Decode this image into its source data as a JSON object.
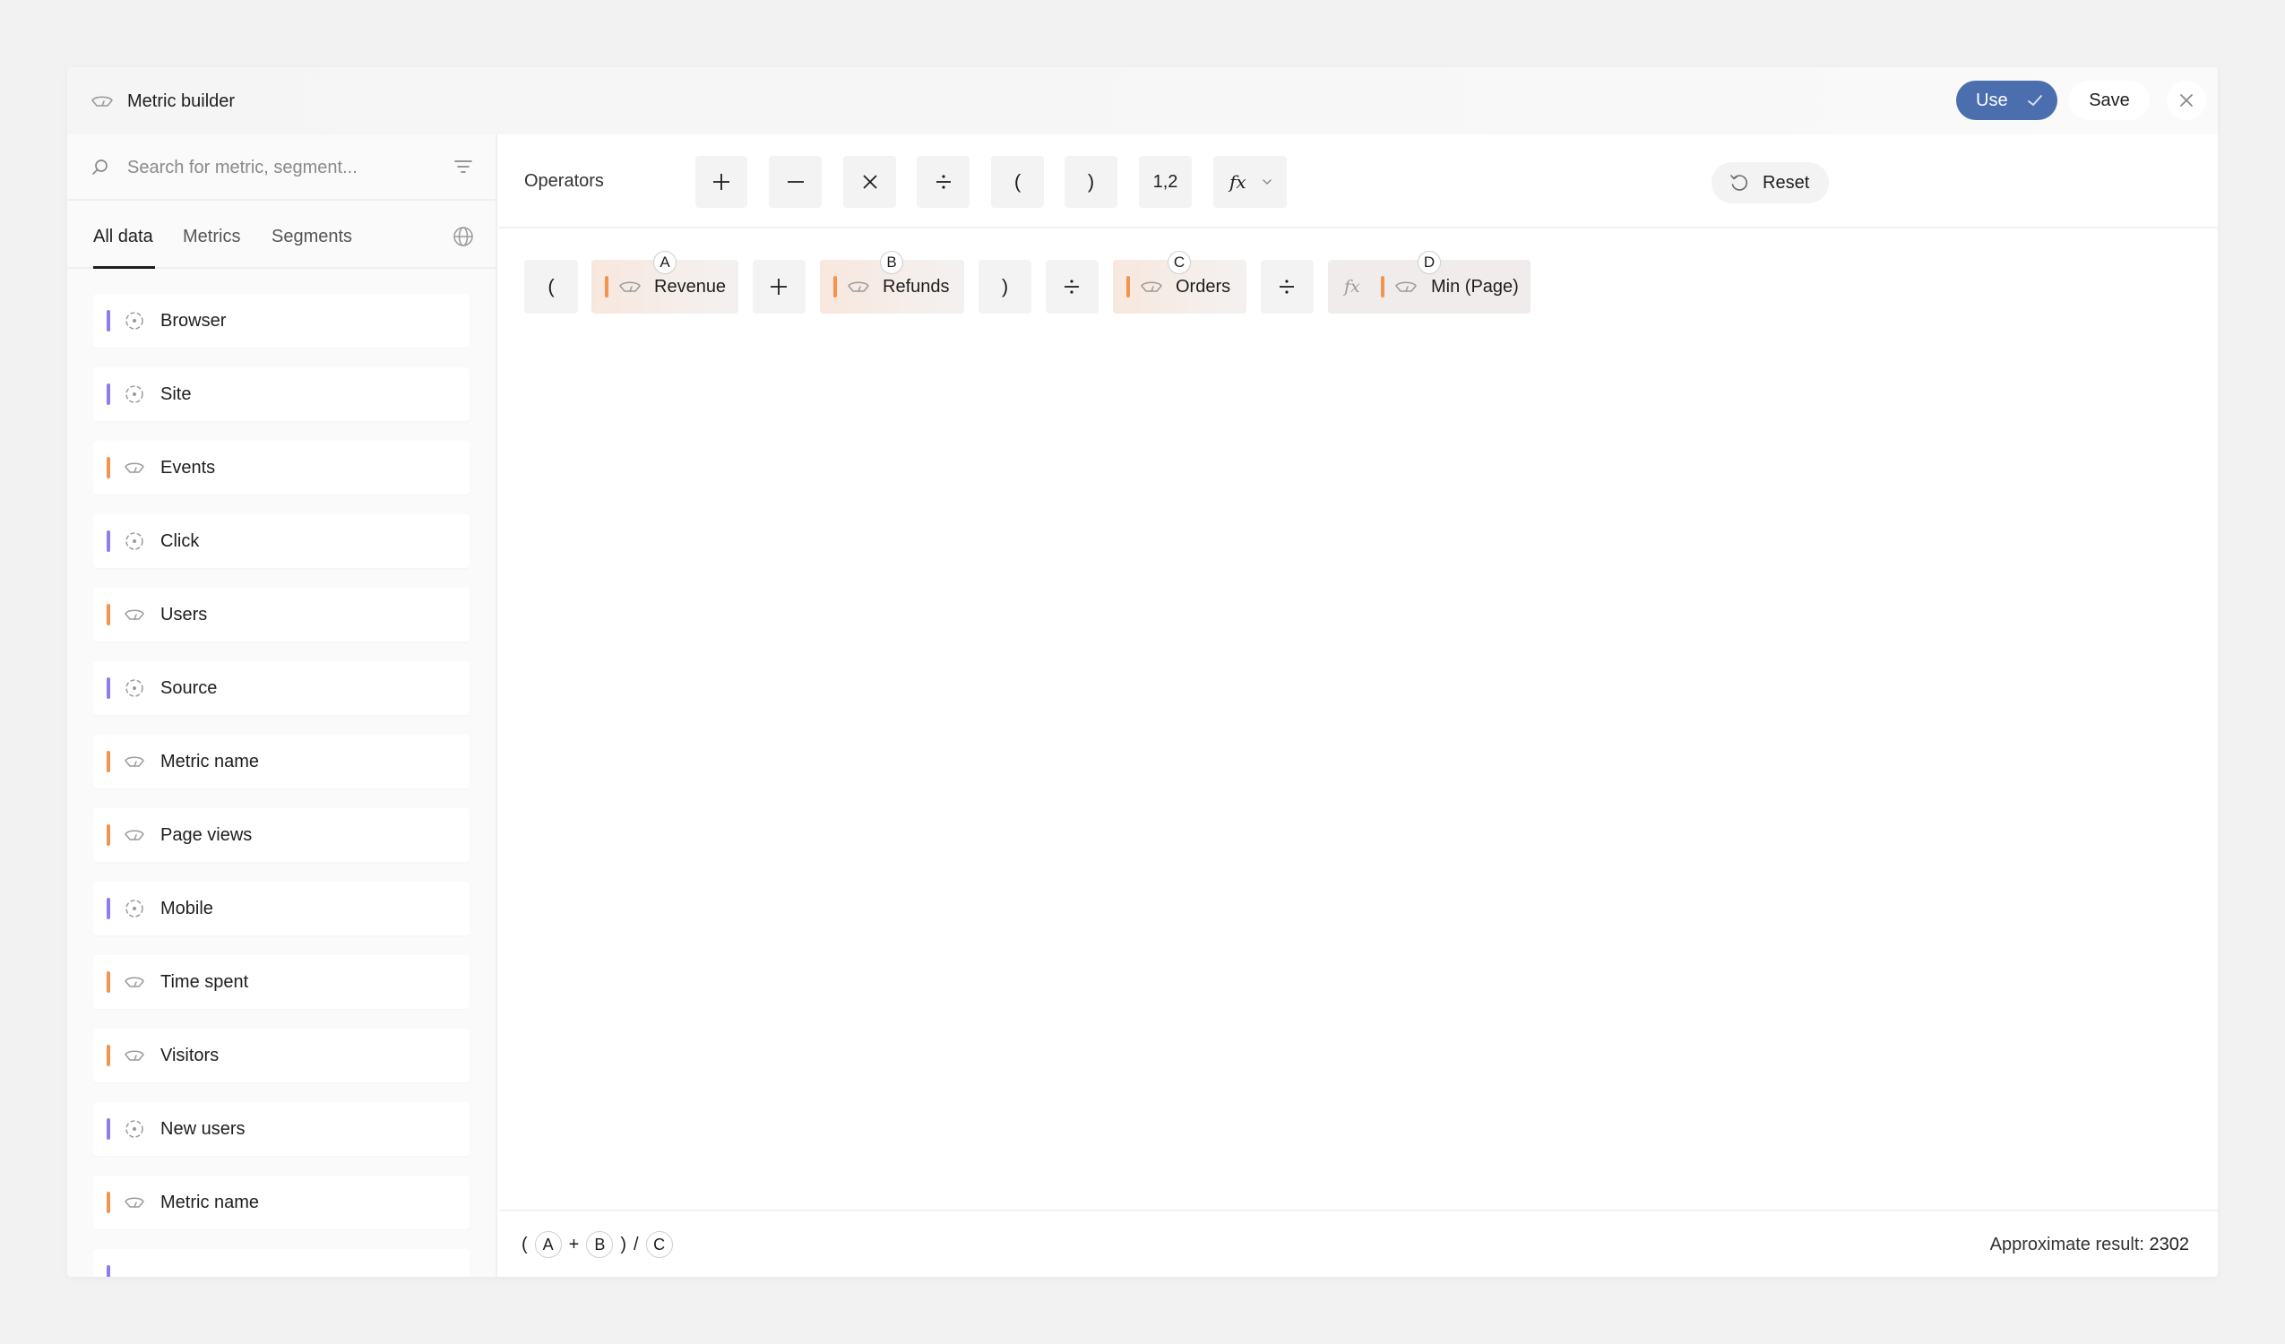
{
  "header": {
    "title": "Metric builder",
    "use_label": "Use",
    "save_label": "Save"
  },
  "sidebar": {
    "search_placeholder": "Search for metric, segment...",
    "tabs": [
      {
        "label": "All data",
        "active": true
      },
      {
        "label": "Metrics",
        "active": false
      },
      {
        "label": "Segments",
        "active": false
      }
    ],
    "items": [
      {
        "label": "Browser",
        "kind": "dimension"
      },
      {
        "label": "Site",
        "kind": "dimension"
      },
      {
        "label": "Events",
        "kind": "metric"
      },
      {
        "label": "Click",
        "kind": "dimension"
      },
      {
        "label": "Users",
        "kind": "metric"
      },
      {
        "label": "Source",
        "kind": "dimension"
      },
      {
        "label": "Metric name",
        "kind": "metric"
      },
      {
        "label": "Page views",
        "kind": "metric"
      },
      {
        "label": "Mobile",
        "kind": "dimension"
      },
      {
        "label": "Time spent",
        "kind": "metric"
      },
      {
        "label": "Visitors",
        "kind": "metric"
      },
      {
        "label": "New users",
        "kind": "dimension"
      },
      {
        "label": "Metric name",
        "kind": "metric"
      }
    ]
  },
  "operators": {
    "label": "Operators",
    "paren_open": "(",
    "paren_close": ")",
    "number": "1,2",
    "function": "fx",
    "reset_label": "Reset"
  },
  "formula": {
    "paren_open": "(",
    "paren_close": ")",
    "tokens": [
      {
        "badge": "A",
        "name": "Revenue"
      },
      {
        "badge": "B",
        "name": "Refunds"
      },
      {
        "badge": "C",
        "name": "Orders"
      },
      {
        "badge": "D",
        "name": "Min (Page)",
        "fx": "fx"
      }
    ]
  },
  "footer": {
    "expression": {
      "open": "(",
      "a": "A",
      "plus": "+",
      "b": "B",
      "close": ")",
      "slash": "/",
      "c": "C"
    },
    "approx_label": "Approximate result:",
    "approx_value": "2302"
  },
  "colors": {
    "accent": "#4b6fae",
    "metric_marker": "#f2934e",
    "dimension_marker": "#8e7cf0"
  }
}
